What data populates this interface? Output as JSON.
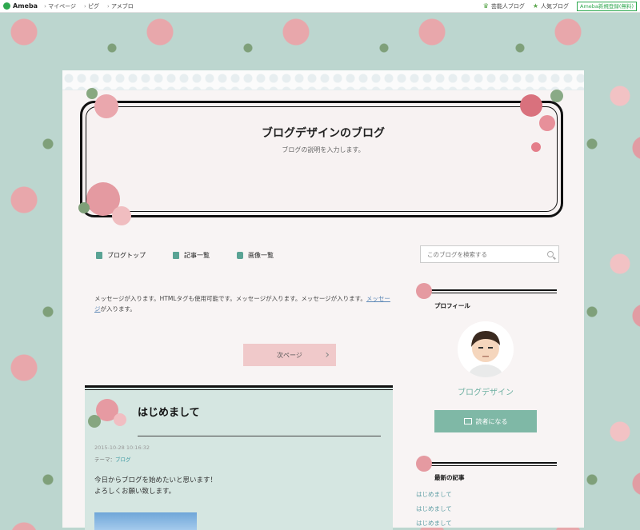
{
  "topbar": {
    "logo": "Ameba",
    "nav": [
      "マイページ",
      "ピグ",
      "アメブロ"
    ],
    "links": [
      "芸能人ブログ",
      "人気ブログ"
    ],
    "register": "Ameba新規登録(無料)"
  },
  "blog": {
    "title": "ブログデザインのブログ",
    "description": "ブログの説明を入力します。"
  },
  "menu": {
    "items": [
      {
        "label": "ブログトップ",
        "icon": "document-icon"
      },
      {
        "label": "記事一覧",
        "icon": "copy-icon"
      },
      {
        "label": "画像一覧",
        "icon": "camera-icon"
      }
    ]
  },
  "search": {
    "placeholder": "このブログを検索する"
  },
  "message": {
    "text1": "メッセージが入ります。HTMLタグも使用可能です。メッセージが入ります。メッセージが入ります。",
    "link": "メッセージ",
    "text2": "が入ります。"
  },
  "pager": {
    "next_label": "次ページ"
  },
  "article": {
    "title": "はじめまして",
    "date": "2015-10-28 10:16:32",
    "theme_label": "テーマ：",
    "theme_value": "ブログ",
    "body_line1": "今日からブログを始めたいと思います！",
    "body_line2": "よろしくお願い致します。"
  },
  "sidebar": {
    "profile_heading": "プロフィール",
    "profile_name": "ブログデザイン",
    "follow_label": "読者になる",
    "recent_heading": "最新の記事",
    "recent_items": [
      "はじめまして",
      "はじめまして",
      "はじめまして"
    ]
  },
  "colors": {
    "accent_teal": "#7fb8a6",
    "pink_button": "#f0c9ca",
    "article_bg": "#d5e6e1",
    "link_blue": "#5a86b5"
  }
}
